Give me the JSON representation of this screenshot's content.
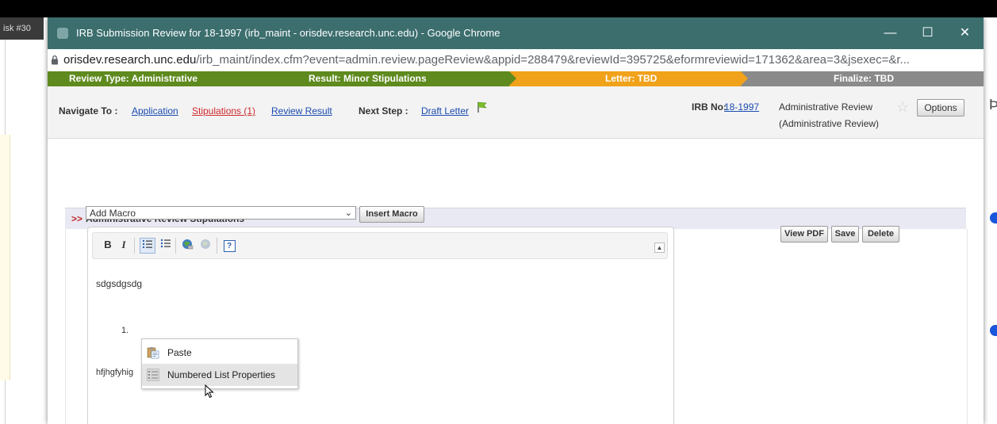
{
  "backdrop": {
    "left_tab": "isk #30"
  },
  "window": {
    "title": "IRB Submission Review for 18-1997 (irb_maint - orisdev.research.unc.edu) - Google Chrome",
    "min_glyph": "—",
    "max_glyph": "☐",
    "close_glyph": "✕",
    "url_host": "orisdev.research.unc.edu",
    "url_rest": "/irb_maint/index.cfm?event=admin.review.pageReview&appid=288479&reviewId=395725&eformreviewid=171362&area=3&jsexec=&r..."
  },
  "workflow": {
    "steps": [
      {
        "label": "Review Type: Administrative",
        "color": "#5e8a1e"
      },
      {
        "label": "Result: Minor Stipulations",
        "color": "#5e8a1e"
      },
      {
        "label": "Letter: TBD",
        "color": "#f0a21a"
      },
      {
        "label": "Finalize: TBD",
        "color": "#8a8a8a"
      }
    ]
  },
  "nav": {
    "label": "Navigate To :",
    "application": "Application",
    "stipulations": "Stipulations (1)",
    "review_result": "Review Result",
    "next_step_label": "Next Step :",
    "draft_letter": "Draft Letter"
  },
  "irb": {
    "label": "IRB No:",
    "number": "18-1997",
    "review_type": "Administrative Review",
    "review_sub": "(Administrative Review)",
    "options": "Options"
  },
  "panel": {
    "arrows": ">>",
    "title": "Administrative Review Stipulations"
  },
  "macro": {
    "selected": "Add Macro",
    "insert": "Insert Macro"
  },
  "actions": {
    "view_pdf": "View PDF",
    "save": "Save",
    "delete": "Delete"
  },
  "toolbar": {
    "bold": "B",
    "italic": "I",
    "help": "?",
    "collapse": "▲"
  },
  "editor": {
    "line1": "sdgsdgsdg",
    "list_marker": "1.",
    "line2": "hfjhgfyhig"
  },
  "context_menu": {
    "items": [
      {
        "label": "Paste"
      },
      {
        "label": "Numbered List Properties"
      }
    ]
  }
}
